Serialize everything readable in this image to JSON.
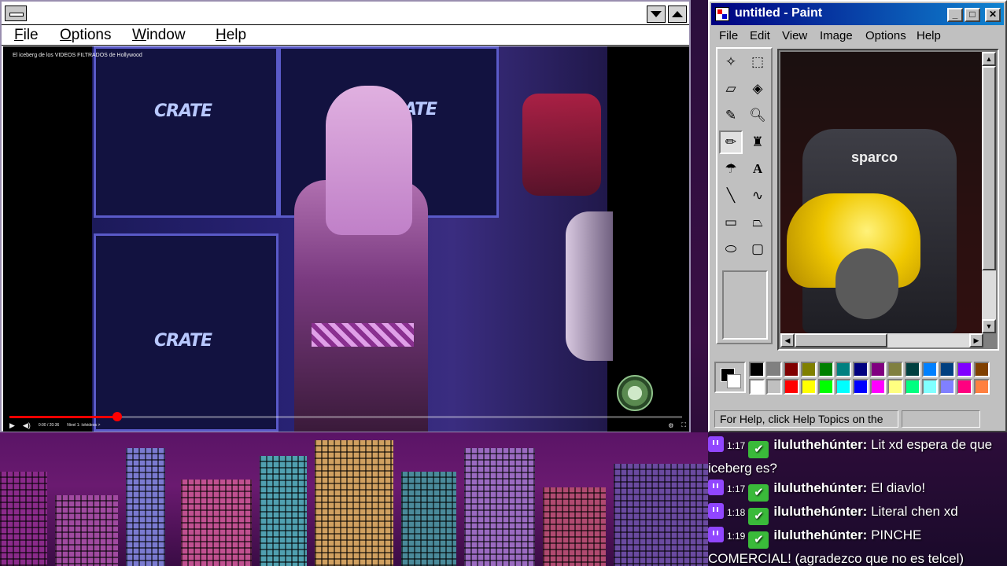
{
  "left_window": {
    "menu": [
      "File",
      "Options",
      "Window",
      "Help"
    ]
  },
  "video": {
    "title": "El iceberg de los VIDEOS FILTRADOS de Hollywood",
    "brand_text": "CRATE",
    "time": "0:00 / 20:36",
    "chapter": "Nivel 1: íolvideos >",
    "progress_fraction": 0.16
  },
  "paint": {
    "title": "untitled - Paint",
    "menu": [
      "File",
      "Edit",
      "View",
      "Image",
      "Options",
      "Help"
    ],
    "status": "For Help, click Help Topics on the",
    "canvas_text": "sparco",
    "palette_row1": [
      "#000000",
      "#808080",
      "#800000",
      "#808000",
      "#008000",
      "#008080",
      "#000080",
      "#800080",
      "#808040",
      "#004040",
      "#0080ff",
      "#004080",
      "#8000ff",
      "#804000"
    ],
    "palette_row2": [
      "#ffffff",
      "#c0c0c0",
      "#ff0000",
      "#ffff00",
      "#00ff00",
      "#00ffff",
      "#0000ff",
      "#ff00ff",
      "#ffff80",
      "#00ff80",
      "#80ffff",
      "#8080ff",
      "#ff0080",
      "#ff8040"
    ]
  },
  "chat": {
    "messages": [
      {
        "time": "1:17",
        "user": "iluluthehúnter:",
        "text": "Lit xd espera de que iceberg es?"
      },
      {
        "time": "1:17",
        "user": "iluluthehúnter:",
        "text": "El diavlo!"
      },
      {
        "time": "1:18",
        "user": "iluluthehúnter:",
        "text": "Literal chen xd"
      },
      {
        "time": "1:19",
        "user": "iluluthehúnter:",
        "text": "PINCHE COMERCIAL! (agradezco que no es telcel)"
      }
    ]
  }
}
